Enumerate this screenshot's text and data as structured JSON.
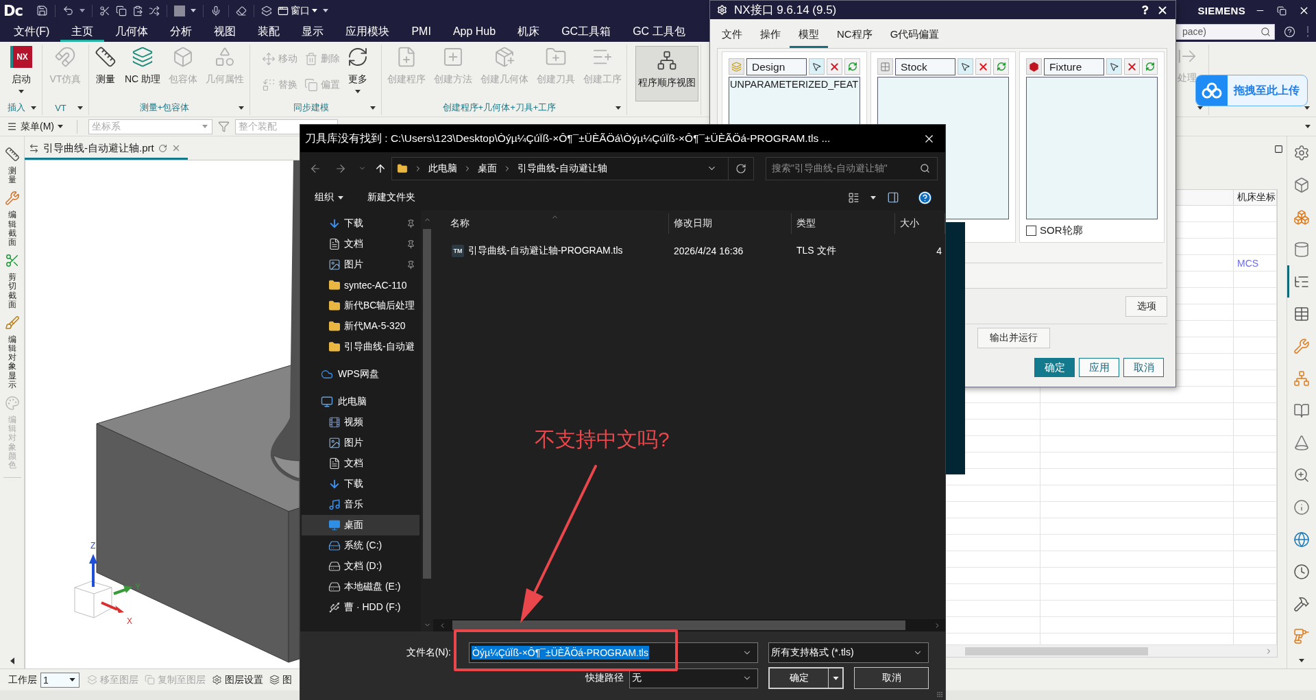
{
  "title_bar": {
    "logo": "Dc",
    "window_menu": "窗口",
    "brand": "SIEMENS"
  },
  "menu_tabs": [
    {
      "label": "文件(F)",
      "selected": false
    },
    {
      "label": "主页",
      "selected": true
    },
    {
      "label": "几何体",
      "selected": false
    },
    {
      "label": "分析",
      "selected": false
    },
    {
      "label": "视图",
      "selected": false
    },
    {
      "label": "装配",
      "selected": false
    },
    {
      "label": "显示",
      "selected": false
    },
    {
      "label": "应用模块",
      "selected": false
    },
    {
      "label": "PMI",
      "selected": false
    },
    {
      "label": "App Hub",
      "selected": false
    },
    {
      "label": "机床",
      "selected": false
    },
    {
      "label": "GC工具箱",
      "selected": false
    },
    {
      "label": "GC 工具包",
      "selected": false
    }
  ],
  "command_search": {
    "value": "pace)"
  },
  "ribbon": {
    "groups": [
      {
        "label": "插入",
        "items": [
          {
            "label": "启动",
            "kind": "menu",
            "disabled": false,
            "icon_text": "NX"
          }
        ]
      },
      {
        "label": "VT",
        "items": [
          {
            "label": "VT仿真",
            "kind": "large",
            "disabled": true
          }
        ]
      },
      {
        "label": "测量+包容体",
        "items": [
          {
            "label": "测量",
            "kind": "large",
            "disabled": false
          },
          {
            "label": "NC 助理",
            "kind": "large",
            "disabled": false
          },
          {
            "label": "包容体",
            "kind": "large",
            "disabled": true
          },
          {
            "label": "几何属性",
            "kind": "large",
            "disabled": true
          }
        ]
      },
      {
        "label": "同步建模",
        "items": [
          {
            "label": "移动",
            "kind": "small",
            "disabled": true
          },
          {
            "label": "删除",
            "kind": "small",
            "disabled": true
          },
          {
            "label": "替换",
            "kind": "small",
            "disabled": true
          },
          {
            "label": "偏置",
            "kind": "small",
            "disabled": true
          },
          {
            "label": "更多",
            "kind": "menu",
            "disabled": false
          }
        ]
      },
      {
        "label": "创建程序+几何体+刀具+工序",
        "items": [
          {
            "label": "创建程序",
            "kind": "large",
            "disabled": true
          },
          {
            "label": "创建方法",
            "kind": "large",
            "disabled": true
          },
          {
            "label": "创建几何体",
            "kind": "large",
            "disabled": true
          },
          {
            "label": "创建刀具",
            "kind": "large",
            "disabled": true
          },
          {
            "label": "创建工序",
            "kind": "large",
            "disabled": true
          }
        ]
      }
    ],
    "program_order_view": {
      "label": "程序顺序视图",
      "pressed": true
    },
    "post_item": {
      "label": "处理",
      "disabled": true
    }
  },
  "toolbar": {
    "menu": "菜单(M)",
    "csys": {
      "placeholder": "坐标系"
    },
    "scope": {
      "placeholder": "整个装配"
    }
  },
  "side_toolbar": [
    {
      "label": "测量",
      "disabled": false
    },
    {
      "label": "编辑截面",
      "disabled": false
    },
    {
      "label": "剪切截面",
      "disabled": false
    },
    {
      "label": "编辑对象显示",
      "disabled": false
    },
    {
      "label": "编辑对象颜色",
      "disabled": true
    }
  ],
  "part_tab": {
    "label": "引导曲线-自动避让轴.prt"
  },
  "triad": {
    "axes": [
      {
        "label": "Z"
      },
      {
        "label": "Y"
      },
      {
        "label": "X"
      }
    ]
  },
  "navigator": {
    "column_header": "机床坐标",
    "cell": "MCS"
  },
  "resource_bar": [
    {
      "selected": false
    },
    {
      "selected": false
    },
    {
      "selected": false
    },
    {
      "selected": false
    },
    {
      "selected": true
    },
    {
      "selected": false
    },
    {
      "selected": false
    },
    {
      "selected": false
    },
    {
      "selected": false
    },
    {
      "selected": false
    },
    {
      "selected": false
    },
    {
      "selected": false
    },
    {
      "selected": false
    },
    {
      "selected": false
    },
    {
      "selected": false
    },
    {
      "selected": false
    }
  ],
  "upload_widget": {
    "label": "拖拽至此上传"
  },
  "status_bar": {
    "layer_label": "工作层",
    "layer_value": "1",
    "items": [
      {
        "label": "移至图层",
        "disabled": true
      },
      {
        "label": "复制至图层",
        "disabled": true
      },
      {
        "label": "图层设置",
        "disabled": false
      },
      {
        "label": "图",
        "disabled": false
      }
    ]
  },
  "nx_dialog": {
    "title": "NX接口 9.6.14 (9.5)",
    "tabs": [
      {
        "label": "文件",
        "selected": false
      },
      {
        "label": "操作",
        "selected": false
      },
      {
        "label": "模型",
        "selected": true
      },
      {
        "label": "NC程序",
        "selected": false
      },
      {
        "label": "G代码偏置",
        "selected": false
      }
    ],
    "panels": [
      {
        "label": "Design",
        "items": [
          "UNPARAMETERIZED_FEAT"
        ]
      },
      {
        "label": "Stock"
      },
      {
        "label": "Fixture",
        "option": {
          "label": "SOR轮廓",
          "checked": false
        }
      }
    ],
    "options_button": "选项",
    "run_button": "输出并运行",
    "buttons": [
      {
        "label": "确定",
        "kind": "primary"
      },
      {
        "label": "应用",
        "kind": "secondary"
      },
      {
        "label": "取消",
        "kind": "secondary"
      }
    ]
  },
  "file_dialog": {
    "title": "刀具库没有找到 : C:\\Users\\123\\Desktop\\Òýµ¼ÇúÏß-×Ô¶¯±ÜÈÃÖá\\Òýµ¼ÇúÏß-×Ô¶¯±ÜÈÃÖá-PROGRAM.tls ...",
    "breadcrumb": [
      "此电脑",
      "桌面",
      "引导曲线-自动避让轴"
    ],
    "search": {
      "placeholder": "搜索\"引导曲线-自动避让轴\""
    },
    "organize": "组织",
    "new_folder": "新建文件夹",
    "quick_access": [
      {
        "label": "下载",
        "kind": "downloads",
        "pinned": true,
        "selected": false
      },
      {
        "label": "文档",
        "kind": "documents",
        "pinned": true,
        "selected": false
      },
      {
        "label": "图片",
        "kind": "pictures",
        "pinned": true,
        "selected": false
      },
      {
        "label": "syntec-AC-110",
        "kind": "folder",
        "pinned": false,
        "selected": false
      },
      {
        "label": "新代BC轴后处理",
        "kind": "folder",
        "pinned": false,
        "selected": false
      },
      {
        "label": "新代MA-5-320",
        "kind": "folder",
        "pinned": false,
        "selected": false
      },
      {
        "label": "引导曲线-自动避",
        "kind": "folder",
        "pinned": false,
        "selected": false
      }
    ],
    "locations": [
      {
        "label": "WPS网盘",
        "kind": "cloud",
        "selected": false
      },
      {
        "label": "此电脑",
        "kind": "pc",
        "selected": false,
        "children": [
          {
            "label": "视频",
            "kind": "videos",
            "selected": false
          },
          {
            "label": "图片",
            "kind": "pictures",
            "selected": false
          },
          {
            "label": "文档",
            "kind": "documents",
            "selected": false
          },
          {
            "label": "下载",
            "kind": "downloads",
            "selected": false
          },
          {
            "label": "音乐",
            "kind": "music",
            "selected": false
          },
          {
            "label": "桌面",
            "kind": "desktop",
            "selected": true
          },
          {
            "label": "系统 (C:)",
            "kind": "system_drive",
            "selected": false
          },
          {
            "label": "文档 (D:)",
            "kind": "drive",
            "selected": false
          },
          {
            "label": "本地磁盘 (E:)",
            "kind": "drive",
            "selected": false
          },
          {
            "label": "曹 · HDD (F:)",
            "kind": "external_drive",
            "selected": false
          }
        ]
      }
    ],
    "columns": [
      "名称",
      "修改日期",
      "类型",
      "大小"
    ],
    "files": [
      {
        "name": "引导曲线-自动避让轴-PROGRAM.tls",
        "icon_text": "TM",
        "modified": "2026/4/24 16:36",
        "type": "TLS 文件",
        "size": "4"
      }
    ],
    "filename_label": "文件名(N):",
    "filename": {
      "value": "Òýµ¼ÇúÏß-×Ô¶¯±ÜÈÃÖá-PROGRAM.tls",
      "text_selected": true
    },
    "filter": "所有支持格式 (*.tls)",
    "shortcut_label": "快捷路径",
    "shortcut": "无",
    "ok": "确定",
    "cancel": "取消"
  },
  "annotation": {
    "text": "不支持中文吗?"
  }
}
